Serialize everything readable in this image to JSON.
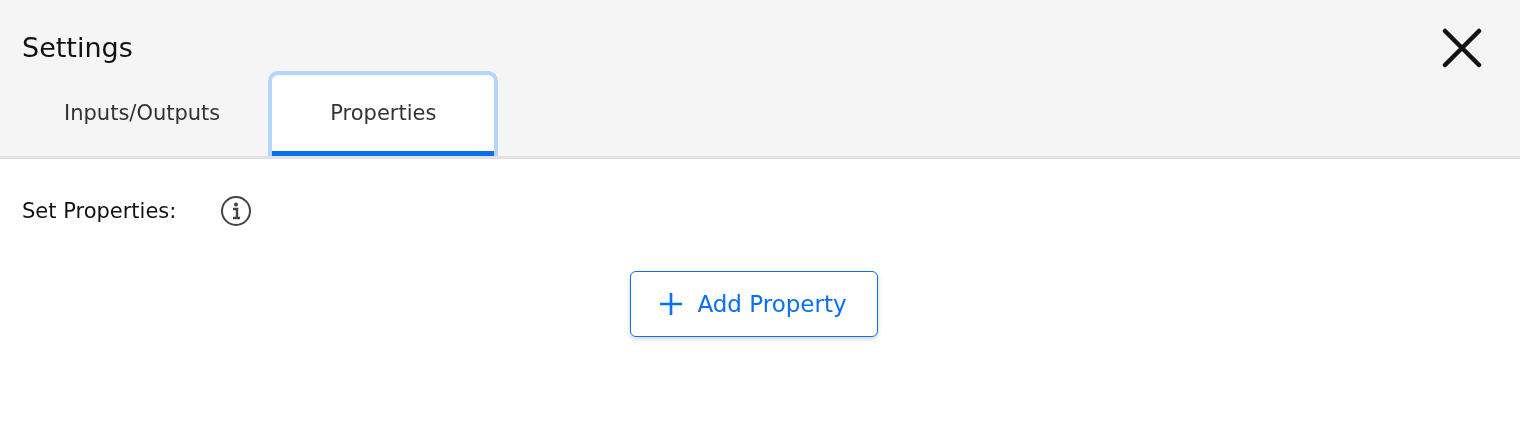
{
  "window": {
    "title": "Settings"
  },
  "tabs": [
    {
      "label": "Inputs/Outputs",
      "selected": false
    },
    {
      "label": "Properties",
      "selected": true
    }
  ],
  "section": {
    "label": "Set Properties:"
  },
  "add_button": {
    "label": "Add Property"
  }
}
